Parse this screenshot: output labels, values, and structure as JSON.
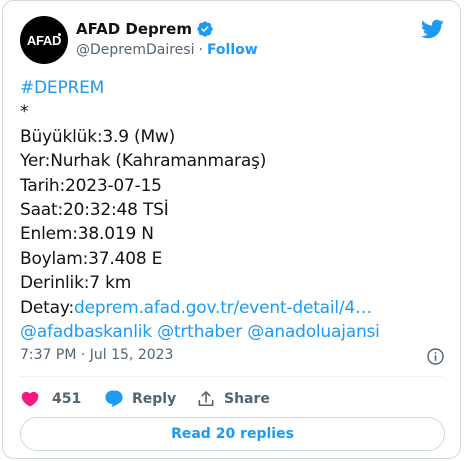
{
  "account": {
    "avatar_text": "AFAD",
    "name": "AFAD Deprem",
    "handle": "@DepremDairesi",
    "separator": "·",
    "follow_label": "Follow"
  },
  "tweet": {
    "hashtag": "#DEPREM",
    "asterisk": "*",
    "lines": [
      "Büyüklük:3.9 (Mw)",
      "Yer:Nurhak (Kahramanmaraş)",
      "Tarih:2023-07-15",
      "Saat:20:32:48 TSİ",
      "Enlem:38.019 N",
      "Boylam:37.408 E",
      "Derinlik:7 km"
    ],
    "detail_label": "Detay:",
    "detail_link": "deprem.afad.gov.tr/event-detail/4…",
    "mentions": [
      "@afadbaskanlik",
      "@trthaber",
      "@anadoluajansi"
    ],
    "timestamp": "7:37 PM · Jul 15, 2023"
  },
  "actions": {
    "like_count": "451",
    "reply_label": "Reply",
    "share_label": "Share"
  },
  "replies_button": "Read 20 replies",
  "colors": {
    "accent": "#1d9bf0",
    "text": "#0f1419",
    "muted": "#536471",
    "like": "#f91880",
    "border": "#cfd9de"
  },
  "icons": [
    "verified-badge-icon",
    "twitter-bird-icon",
    "info-icon",
    "heart-icon",
    "reply-bubble-icon",
    "share-icon"
  ]
}
